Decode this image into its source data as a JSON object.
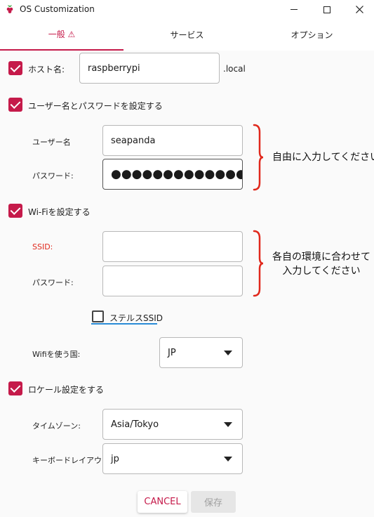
{
  "window": {
    "title": "OS Customization",
    "minimize": "—",
    "maximize": "☐",
    "close": "✕"
  },
  "tabs": [
    {
      "label": "一般 ⚠"
    },
    {
      "label": "サービス"
    },
    {
      "label": "オプション"
    }
  ],
  "general": {
    "hostname": {
      "checked": true,
      "label": "ホスト名:",
      "value": "raspberrypi",
      "suffix": ".local"
    },
    "user": {
      "checked": true,
      "label": "ユーザー名とパスワードを設定する",
      "username_label": "ユーザー名",
      "username_value": "seapanda",
      "password_label": "パスワード:",
      "password_value": "●●●●●●●●●●●●●●"
    },
    "wifi": {
      "checked": true,
      "label": "Wi-Fiを設定する",
      "ssid_label": "SSID:",
      "ssid_value": "",
      "password_label": "パスワード:",
      "password_value": "",
      "hidden_ssid_checked": false,
      "hidden_ssid_label": "ステルスSSID",
      "country_label": "Wifiを使う国:",
      "country_value": "JP"
    },
    "locale": {
      "checked": true,
      "label": "ロケール設定をする",
      "timezone_label": "タイムゾーン:",
      "timezone_value": "Asia/Tokyo",
      "keyboard_label": "キーボードレイアウト:",
      "keyboard_value": "jp"
    }
  },
  "annotations": {
    "user_note": "自由に入力してください",
    "wifi_note_line1": "各自の環境に合わせて",
    "wifi_note_line2": "入力してください",
    "bracket_color": "#e0281c"
  },
  "buttons": {
    "cancel": "CANCEL",
    "save": "保存"
  },
  "colors": {
    "accent": "#c51a4a",
    "warning_label": "#e0281c",
    "focus_underline": "#2a8bd6"
  }
}
